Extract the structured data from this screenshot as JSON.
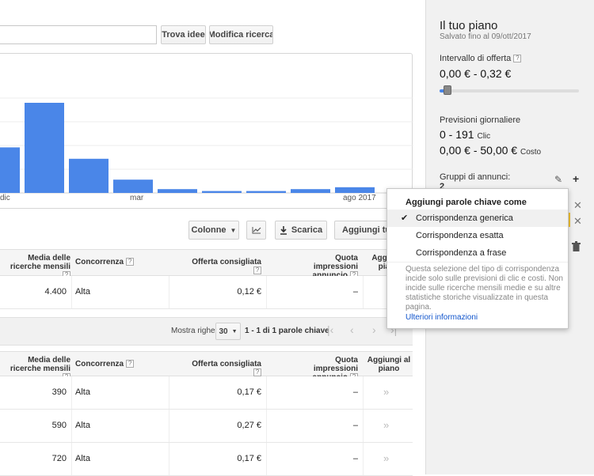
{
  "search": {
    "value": ""
  },
  "buttons": {
    "find_ideas": "Trova idee",
    "edit_search": "Modifica ricerca"
  },
  "chart_data": {
    "type": "bar",
    "categories": [
      "",
      "",
      "",
      "",
      "",
      "",
      "",
      "",
      "",
      ""
    ],
    "values": [
      48,
      95,
      36,
      14,
      4,
      2,
      2,
      4,
      6
    ],
    "xticks": [
      "dic",
      "mar",
      "ago 2017"
    ],
    "color": "#4a86e8"
  },
  "toolbar": {
    "columns": "Colonne",
    "download": "Scarica",
    "add_all": "Aggiungi tutte"
  },
  "table_headers": {
    "avg_searches": "Media delle ricerche mensili",
    "competition": "Concorrenza",
    "suggested_bid": "Offerta consigliata",
    "impression_share": "Quota impressioni annuncio",
    "add_to_plan_partial": "Aggiungi piano",
    "add_to_plan": "Aggiungi al piano"
  },
  "top_row": {
    "searches": "4.400",
    "competition": "Alta",
    "bid": "0,12 €",
    "share": "–"
  },
  "pager": {
    "label": "Mostra righe:",
    "rows": "30",
    "range": "1 - 1 di 1 parole chiave"
  },
  "rows": [
    {
      "searches": "390",
      "competition": "Alta",
      "bid": "0,17 €",
      "share": "–"
    },
    {
      "searches": "590",
      "competition": "Alta",
      "bid": "0,27 €",
      "share": "–"
    },
    {
      "searches": "720",
      "competition": "Alta",
      "bid": "0,17 €",
      "share": "–"
    }
  ],
  "plan": {
    "title": "Il tuo piano",
    "saved": "Salvato fino al 09/ott/2017",
    "bid_range_label": "Intervallo di offerta",
    "bid_range": "0,00 € - 0,32 €",
    "slider_level": 0.03,
    "forecast_label": "Previsioni giornaliere",
    "clicks": "0 - 191",
    "clicks_unit": "Clic",
    "cost": "0,00 € - 50,00 €",
    "cost_unit": "Costo",
    "ad_groups_label": "Gruppi di annunci:",
    "ad_groups_count": "2"
  },
  "popup": {
    "title": "Aggiungi parole chiave come",
    "options": [
      "Corrispondenza generica",
      "Corrispondenza esatta",
      "Corrispondenza a frase"
    ],
    "selected": 0,
    "description": "Questa selezione del tipo di corrispondenza incide solo sulle previsioni di clic e costi. Non incide sulle ricerche mensili medie e su altre statistiche storiche visualizzate in questa pagina.",
    "link": "Ulteriori informazioni"
  }
}
